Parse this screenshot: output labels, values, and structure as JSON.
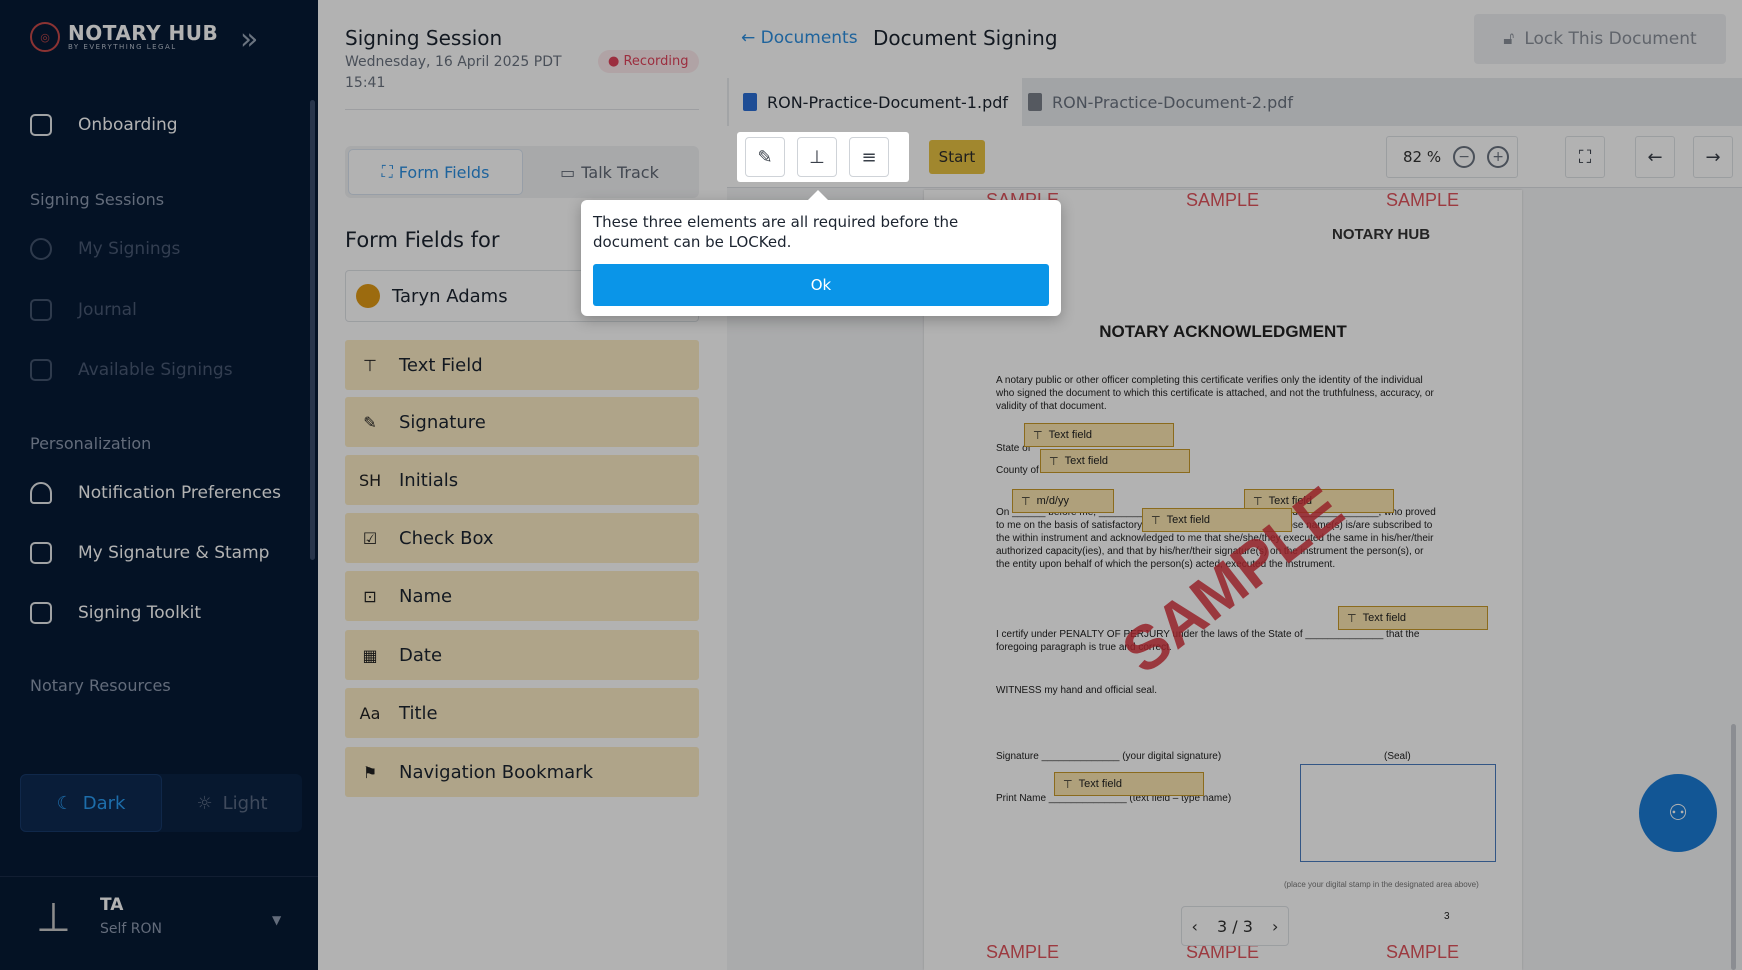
{
  "sidebar": {
    "brand": "NOTARY HUB",
    "brand_sub": "BY EVERYTHING LEGAL",
    "onboarding": "Onboarding",
    "sec_signing": "Signing Sessions",
    "my_signings": "My Signings",
    "journal": "Journal",
    "available": "Available Signings",
    "sec_personal": "Personalization",
    "notif": "Notification Preferences",
    "sigstamp": "My Signature & Stamp",
    "toolkit": "Signing Toolkit",
    "sec_resources": "Notary Resources",
    "theme_dark": "Dark",
    "theme_light": "Light",
    "user_initials": "TA",
    "user_role": "Self RON"
  },
  "session": {
    "title": "Signing Session",
    "date": "Wednesday, 16 April 2025   PDT 15:41",
    "recording": "Recording"
  },
  "tabs": {
    "form_fields": "Form Fields",
    "talk_track": "Talk Track"
  },
  "form_fields": {
    "title": "Form Fields for",
    "signer": "Taryn Adams",
    "items": [
      "Text Field",
      "Signature",
      "Initials",
      "Check Box",
      "Name",
      "Date",
      "Title",
      "Navigation Bookmark"
    ],
    "icons": [
      "text-field-icon",
      "signature-icon",
      "initials-icon",
      "checkbox-icon",
      "name-icon",
      "calendar-icon",
      "title-icon",
      "bookmark-icon"
    ]
  },
  "header": {
    "back": "Documents",
    "title": "Document Signing",
    "lock": "Lock This Document"
  },
  "doc_tabs": [
    "RON-Practice-Document-1.pdf",
    "RON-Practice-Document-2.pdf"
  ],
  "toolbar": {
    "start": "Start",
    "zoom": "82 %"
  },
  "document": {
    "watermark": "SAMPLE",
    "logo": "NOTARY HUB",
    "heading": "NOTARY ACKNOWLEDGMENT",
    "para1": "A notary public or other officer completing this certificate verifies only the identity of the individual who signed the document to which this certificate is attached, and not the truthfulness, accuracy, or validity of that document.",
    "state": "State of",
    "county": "County of",
    "on_text": "On ______ before me, __________________ , personally appeared ______________, who proved to me on the basis of satisfactory evidence to be the person(s) whose name(s) is/are subscribed to the within instrument and acknowledged to me that she/she/they executed the same in his/her/their authorized capacity(ies), and that by his/her/their signature(s) on the instrument the person(s), or the entity upon behalf of which the person(s) acted, executed the instrument.",
    "certify": "I certify under PENALTY OF PERJURY under the laws of the State of ______________ that the foregoing paragraph is true and correct.",
    "witness": "WITNESS my hand and official seal.",
    "signature": "Signature ______________ (your digital signature)",
    "seal": "(Seal)",
    "print_name": "Print Name ______________ (text field – type name)",
    "stamp_note": "(place your digital stamp in the designated area above)",
    "page_num": "3",
    "tf_label": "Text field",
    "date_label": "m/d/yy"
  },
  "pager": "3 / 3",
  "popup": {
    "text": "These three elements are all required before the document can be LOCKed.",
    "ok": "Ok"
  }
}
